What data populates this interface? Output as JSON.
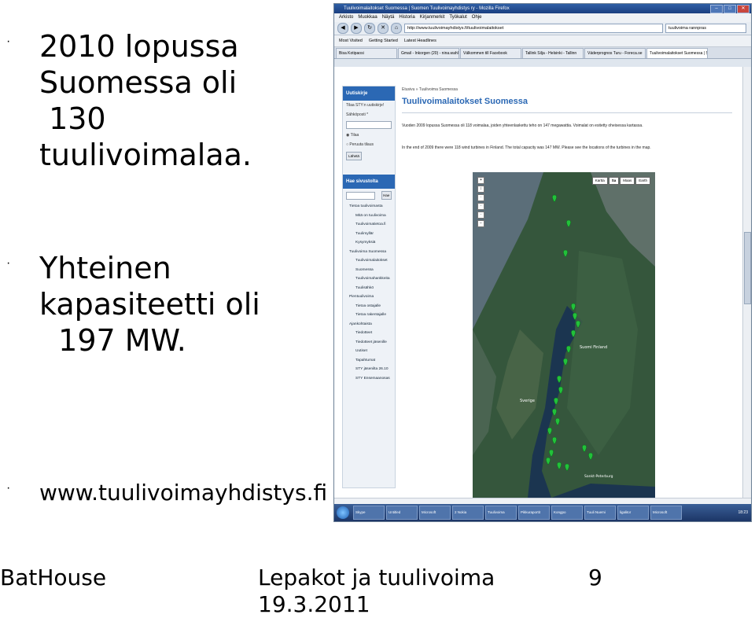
{
  "slide": {
    "bullets": [
      {
        "lines": [
          "2010 lopussa",
          "Suomessa oli",
          " 130",
          "tuulivoimalaa."
        ]
      },
      {
        "lines": [
          "Yhteinen",
          "kapasiteetti oli",
          "  197 MW."
        ]
      },
      {
        "lines": [
          "www.tuulivoimayhdistys.fi"
        ]
      }
    ],
    "bullet_glyph": "·",
    "footer": {
      "left": "BatHouse",
      "center_line1": "Lepakot ja tuulivoima",
      "center_line2": "19.3.2011",
      "page_number": "9"
    }
  },
  "browser": {
    "window_title": "Tuulivoimalaitokset Suomessa | Suomen Tuulivoimayhdistys ry - Mozilla Firefox",
    "menu": [
      "Arkisto",
      "Muokkaa",
      "Näytä",
      "Historia",
      "Kirjanmerkit",
      "Työkalut",
      "Ohje"
    ],
    "url": "http://www.tuulivoimayhdistys.fi/tuulivoimalaitokset",
    "search_placeholder": "tuulivoima rannpras",
    "bookmarks": [
      "Most Visited",
      "Getting Started",
      "Latest Headlines"
    ],
    "tabs": [
      "Bisa Kotipaosi",
      "Gmail - Inkorgen (20) - nina.wahl...",
      "Välkommen till Facebook",
      "Tallink Silja - Helsinki - Tallinn",
      "Väderprognos Turu - Foreca.se",
      "Tuulivoimalaitokset Suomessa | S..."
    ],
    "active_tab": 5
  },
  "page": {
    "sidebar": {
      "newsletter_title": "Uutiskirje",
      "newsletter_text": "Tilaa STY:n uutiskirje!",
      "email_label": "Sähköposti *",
      "option_subscribe": "Tilaa",
      "option_unsubscribe": "Peruuta tilaus",
      "submit_label": "Lähetä",
      "search_title": "Hae sivustolta",
      "search_button": "Hae",
      "nav": [
        {
          "label": "Tietoa tuulivoimasta",
          "level": 0
        },
        {
          "label": "Mitä on tuulivoima",
          "level": 1
        },
        {
          "label": "Tuulivoimatietoa.fi",
          "level": 1
        },
        {
          "label": "Tuulimyllär",
          "level": 1
        },
        {
          "label": "Kysymyksiä",
          "level": 1
        },
        {
          "label": "Tuulivoima Suomessa",
          "level": 0
        },
        {
          "label": "Tuulivoimalaitokset",
          "level": 1
        },
        {
          "label": "Suomessa",
          "level": 1
        },
        {
          "label": "Tuulivoimahankkeita",
          "level": 1
        },
        {
          "label": "Tuulisähkö",
          "level": 1
        },
        {
          "label": "Pientuulivoima",
          "level": 0
        },
        {
          "label": "Tietoa ostajalle",
          "level": 1
        },
        {
          "label": "Tietoa rakentajalle",
          "level": 1
        },
        {
          "label": "Ajankohtaista",
          "level": 0
        },
        {
          "label": "Tiedotteet",
          "level": 1
        },
        {
          "label": "Tiedotteet jäsenille",
          "level": 1
        },
        {
          "label": "Uutiset",
          "level": 1
        },
        {
          "label": "Tapahtumat",
          "level": 1
        },
        {
          "label": "STY jäsenilta 26.10",
          "level": 1
        },
        {
          "label": "STY Ensemaanosas",
          "level": 1
        }
      ]
    },
    "breadcrumb": "Etusivu » Tuulivoima Suomessa",
    "title": "Tuulivoimalaitokset Suomessa",
    "para_fi": "Vuoden 2009 lopussa Suomessa oli 118 voimalaa, joiden yhteenlaskettu teho on 147 megawattia. Voimalat on esitetty oheisessa kartassa.",
    "para_en": "In the end of 2009 there were 118 wind turbines in Finland. The total capacity was 147 MW. Please see the locations of the turbines in the map.",
    "map": {
      "types": [
        "Kartta",
        "Sa",
        "Maas",
        "Earth"
      ],
      "active_type": 1,
      "labels": [
        "Suomi Finland",
        "Sverige",
        "Sankt-Peterburg"
      ]
    }
  },
  "taskbar": {
    "buttons": [
      "Skype",
      "Untitled",
      "Microsoft",
      "2 Nokia",
      "Tuulivoima",
      "Pikkuraportit",
      "Kongpo",
      "Tuuli Nuemi",
      "ligalitor",
      "Microsoft"
    ],
    "clock": "18:23"
  },
  "colors": {
    "accent": "#2b68b4",
    "map_pin": "#22c13a"
  }
}
